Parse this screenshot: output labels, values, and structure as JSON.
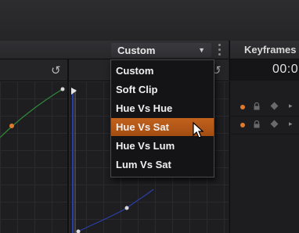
{
  "curve_mode": {
    "selected_label": "Custom",
    "arrow": "▼",
    "options": [
      {
        "label": "Custom"
      },
      {
        "label": "Soft Clip"
      },
      {
        "label": "Hue Vs Hue"
      },
      {
        "label": "Hue Vs Sat",
        "highlighted": true
      },
      {
        "label": "Hue Vs Lum"
      },
      {
        "label": "Lum Vs Sat"
      }
    ]
  },
  "reset_icon": "↺",
  "keyframes": {
    "title": "Keyframes",
    "timecode": "00:0",
    "row_arrow": "▸"
  },
  "colors": {
    "accent": "#c2621d",
    "keyframe_dot": "#e07a2c",
    "curve_green": "#2f8a3a",
    "curve_blue": "#2a3fa8",
    "panel_bg": "#1e1e21"
  },
  "icons": [
    "reset-icon",
    "lock-icon",
    "keyframe-diamond-icon",
    "mouse-cursor-icon",
    "options-dots-icon"
  ]
}
